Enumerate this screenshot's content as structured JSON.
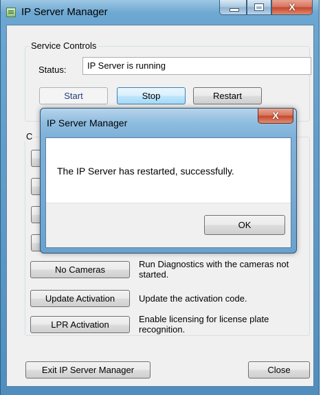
{
  "window": {
    "title": "IP Server Manager"
  },
  "service_controls": {
    "legend": "Service Controls",
    "status_label": "Status:",
    "status_value": "IP Server is running",
    "start_label": "Start",
    "stop_label": "Stop",
    "restart_label": "Restart"
  },
  "commands": {
    "legend_partial": "C",
    "items": [
      {
        "label": "No Cameras",
        "description": "Run Diagnostics with the cameras not started."
      },
      {
        "label": "Update Activation",
        "description": "Update the activation code."
      },
      {
        "label": "LPR Activation",
        "description": "Enable licensing for license plate recognition."
      }
    ]
  },
  "footer": {
    "exit_label": "Exit IP Server Manager",
    "close_label": "Close"
  },
  "dialog": {
    "title": "IP Server Manager",
    "message": "The IP Server has restarted, successfully.",
    "ok_label": "OK"
  },
  "icons": {
    "app": "server-manager-icon",
    "minimize": "minimize-icon",
    "maximize": "maximize-icon",
    "close": "close-icon",
    "close_glyph": "X",
    "dialog_close_glyph": "X"
  },
  "colors": {
    "title_bar": "#6aa6d1",
    "close_button": "#c5452c",
    "client_bg": "#f0f0f0"
  }
}
